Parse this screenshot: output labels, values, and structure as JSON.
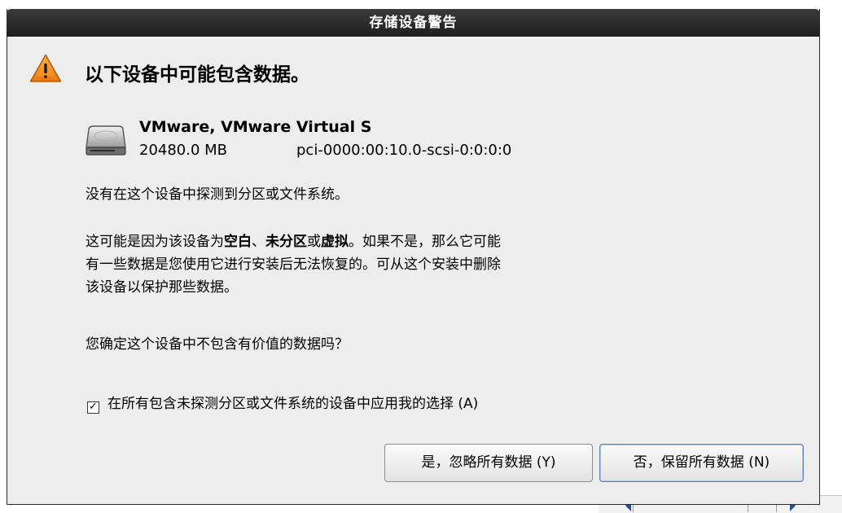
{
  "dialog": {
    "title": "存储设备警告",
    "heading": "以下设备中可能包含数据。",
    "device": {
      "name": "VMware, VMware Virtual S",
      "size": "20480.0 MB",
      "path": "pci-0000:00:10.0-scsi-0:0:0:0"
    },
    "paragraph1": "没有在这个设备中探测到分区或文件系统。",
    "paragraph2": {
      "part1": "这可能是因为该设备为",
      "bold1": "空白",
      "sep1": "、",
      "bold2": "未分区",
      "sep2": "或",
      "bold3": "虚拟",
      "part2": "。如果不是，那么它可能",
      "line2": "有一些数据是您使用它进行安装后无法恢复的。可从这个安装中删除",
      "line3": "该设备以保护那些数据。"
    },
    "paragraph3": "您确定这个设备中不包含有价值的数据吗？",
    "checkbox": {
      "checked": true,
      "label": "在所有包含未探测分区或文件系统的设备中应用我的选择 (A)"
    },
    "buttons": {
      "yes": "是，忽略所有数据 (Y)",
      "no": "否，保留所有数据 (N)"
    }
  },
  "icons": {
    "warning": "warning-triangle-icon",
    "device": "hard-disk-icon"
  },
  "colors": {
    "titlebar": "#2a2a2a",
    "dialog_bg": "#ededed",
    "warning_orange": "#f08a1c",
    "focus_border": "#5e86b7"
  }
}
